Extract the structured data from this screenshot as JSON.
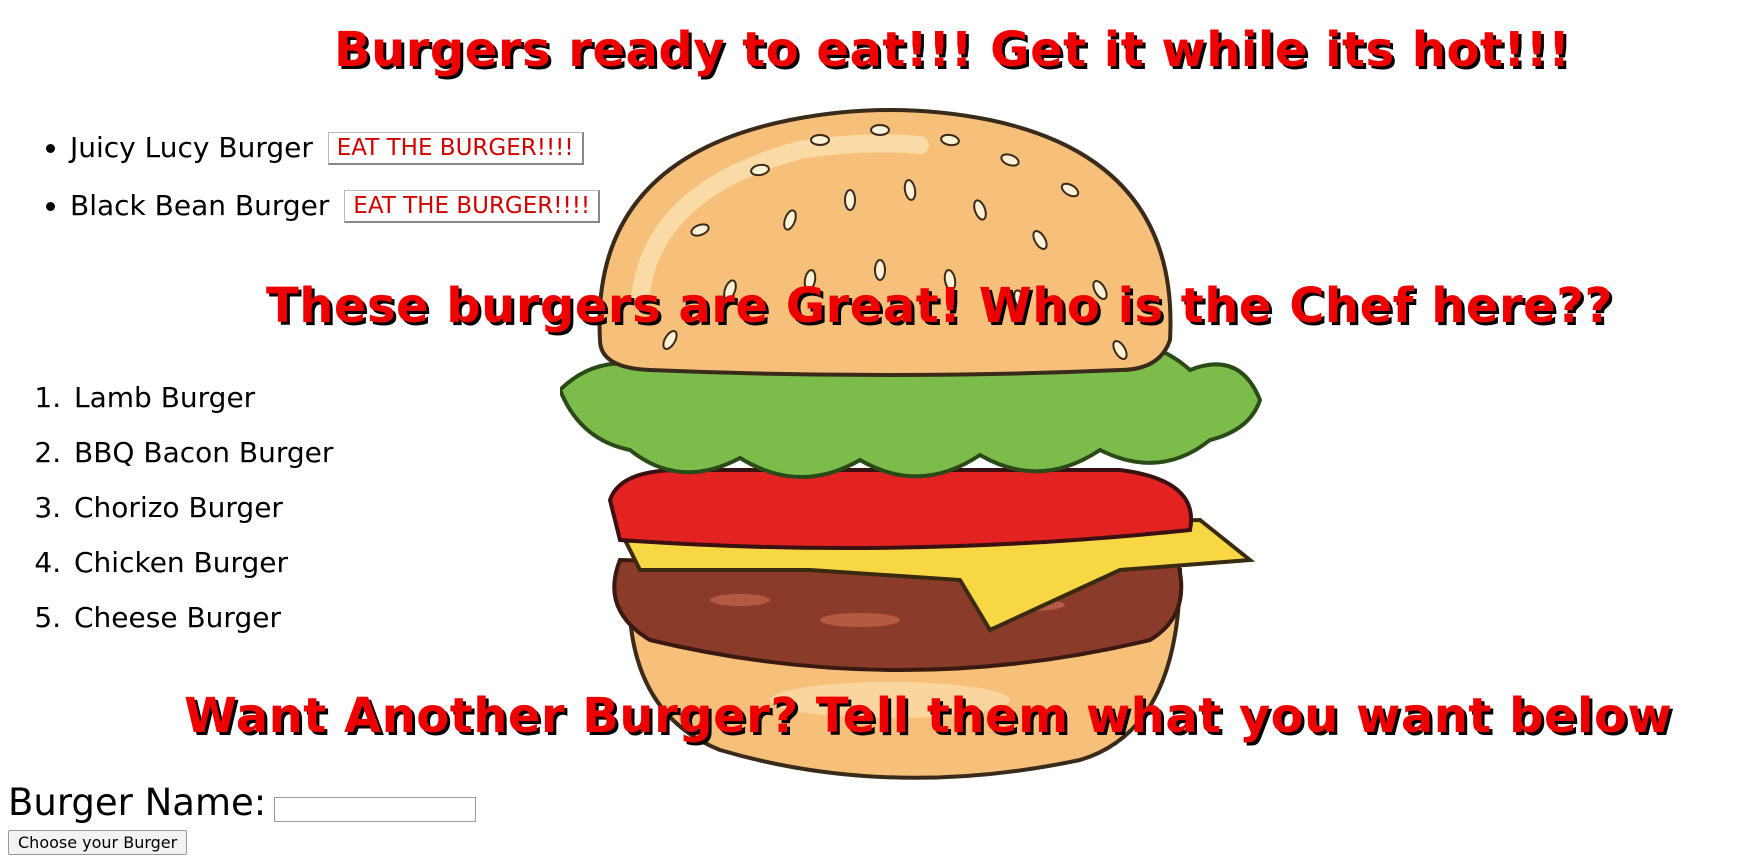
{
  "headings": {
    "ready": "Burgers ready to eat!!! Get it while its hot!!!",
    "devoured": "These burgers are Great! Who is the Chef here??",
    "order": "Want Another Burger? Tell them what you want below"
  },
  "ready_burgers": [
    {
      "name": "Juicy Lucy Burger",
      "button": "EAT THE BURGER!!!!"
    },
    {
      "name": "Black Bean Burger",
      "button": "EAT THE BURGER!!!!"
    }
  ],
  "devoured_burgers": [
    "Lamb Burger",
    "BBQ Bacon Burger",
    "Chorizo Burger",
    "Chicken Burger",
    "Cheese Burger"
  ],
  "form": {
    "label": "Burger Name:",
    "input_value": "",
    "submit_label": "Choose your Burger"
  },
  "colors": {
    "heading": "#ee0000",
    "heading_shadow": "#000000",
    "button_text": "#d00000"
  },
  "icons": {
    "background": "burger-illustration"
  }
}
